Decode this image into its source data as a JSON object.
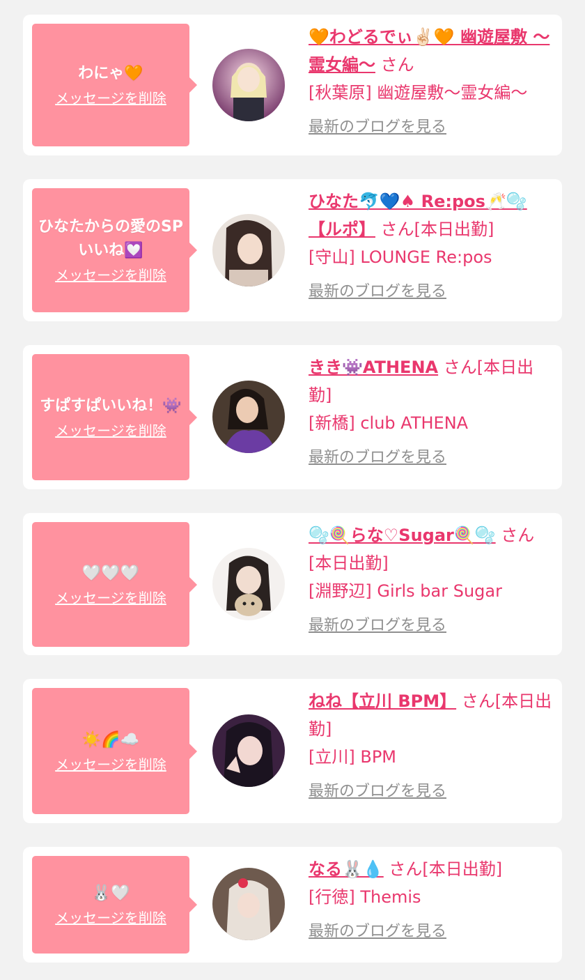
{
  "delete_label": "メッセージを削除",
  "blog_label": "最新のブログを見る",
  "items": [
    {
      "message": "わにゃ🧡",
      "name": "🧡わどるでぃ✌🏻🧡 幽遊屋敷 〜霊女編〜",
      "suffix": "さん",
      "shop": "[秋葉原] 幽遊屋敷〜霊女編〜"
    },
    {
      "message": "ひなたからの愛のSPいいね💟",
      "name": "ひなた🐬💙♠ Re:pos🥂🫧【ルポ】",
      "suffix": "さん[本日出勤]",
      "shop": "[守山] LOUNGE Re:pos"
    },
    {
      "message": "すぱすぱいいね！👾",
      "name": "きき👾ATHENA",
      "suffix": "さん[本日出勤]",
      "shop": "[新橋] club ATHENA"
    },
    {
      "message": "🤍🤍🤍",
      "name": "🫧🍭らな♡Sugar🍭🫧",
      "suffix": "さん[本日出勤]",
      "shop": "[淵野辺] Girls bar Sugar"
    },
    {
      "message": "☀️🌈☁️",
      "name": "ねね【立川 BPM】",
      "suffix": "さん[本日出勤]",
      "shop": "[立川] BPM"
    },
    {
      "message": "🐰🤍",
      "name": "なる🐰💧",
      "suffix": "さん[本日出勤]",
      "shop": "[行徳] Themis"
    }
  ],
  "colors": {
    "bubble": "#ff929f",
    "link": "#e9376d",
    "blog": "#8f8f8f",
    "background": "#f2f2f2"
  }
}
